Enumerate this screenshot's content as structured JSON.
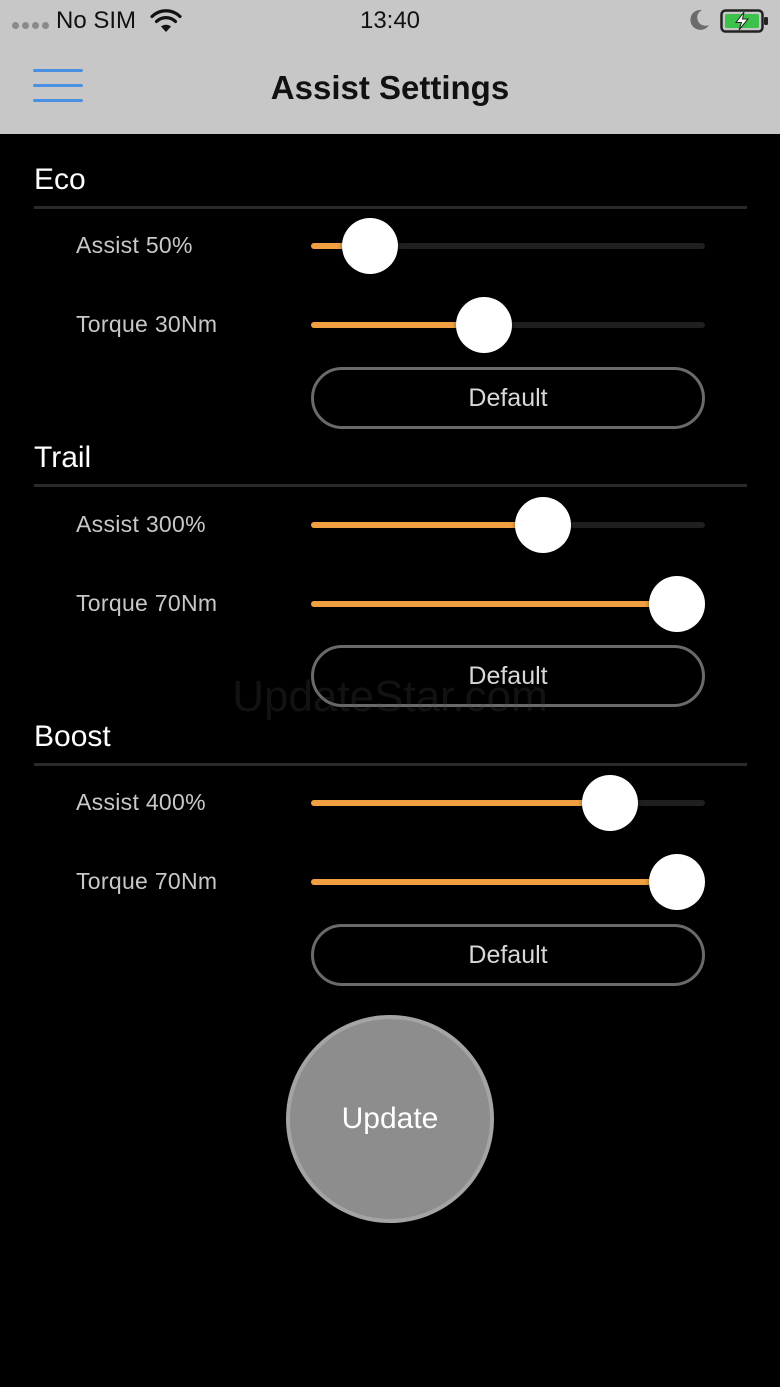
{
  "status_bar": {
    "carrier": "No SIM",
    "time": "13:40",
    "icons": [
      "signal-dots-icon",
      "wifi-icon",
      "moon-icon",
      "battery-charging-icon"
    ]
  },
  "nav": {
    "title": "Assist Settings",
    "menu_icon": "hamburger-menu-icon"
  },
  "colors": {
    "slider_fill": "#f0a040",
    "menu_icon": "#4a90e2",
    "header_bg": "#c7c7c7",
    "update_button": "#8d8d8d"
  },
  "modes": [
    {
      "name": "Eco",
      "assist_label": "Assist 50%",
      "assist_level": 0.15,
      "torque_label": "Torque 30Nm",
      "torque_level": 0.44,
      "default_label": "Default"
    },
    {
      "name": "Trail",
      "assist_label": "Assist 300%",
      "assist_level": 0.59,
      "torque_label": "Torque 70Nm",
      "torque_level": 0.93,
      "default_label": "Default"
    },
    {
      "name": "Boost",
      "assist_label": "Assist 400%",
      "assist_level": 0.76,
      "torque_label": "Torque 70Nm",
      "torque_level": 0.93,
      "default_label": "Default"
    }
  ],
  "watermark": "UpdateStar.com",
  "update_label": "Update"
}
